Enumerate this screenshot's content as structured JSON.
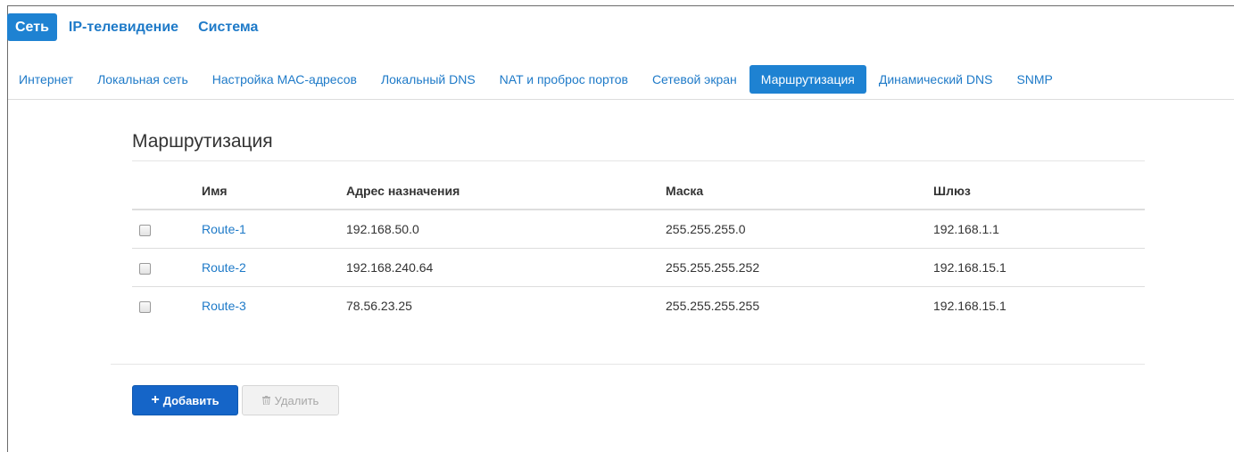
{
  "top_nav": {
    "items": [
      {
        "label": "Сеть",
        "active": true
      },
      {
        "label": "IP-телевидение",
        "active": false
      },
      {
        "label": "Система",
        "active": false
      }
    ]
  },
  "sub_nav": {
    "items": [
      {
        "label": "Интернет",
        "active": false
      },
      {
        "label": "Локальная сеть",
        "active": false
      },
      {
        "label": "Настройка МАС-адресов",
        "active": false
      },
      {
        "label": "Локальный DNS",
        "active": false
      },
      {
        "label": "NAT и проброс портов",
        "active": false
      },
      {
        "label": "Сетевой экран",
        "active": false
      },
      {
        "label": "Маршрутизация",
        "active": true
      },
      {
        "label": "Динамический DNS",
        "active": false
      },
      {
        "label": "SNMP",
        "active": false
      }
    ]
  },
  "page": {
    "title": "Маршрутизация"
  },
  "table": {
    "headers": {
      "name": "Имя",
      "destination": "Адрес назначения",
      "mask": "Маска",
      "gateway": "Шлюз"
    },
    "rows": [
      {
        "name": "Route-1",
        "destination": "192.168.50.0",
        "mask": "255.255.255.0",
        "gateway": "192.168.1.1",
        "checked": false
      },
      {
        "name": "Route-2",
        "destination": "192.168.240.64",
        "mask": "255.255.255.252",
        "gateway": "192.168.15.1",
        "checked": false
      },
      {
        "name": "Route-3",
        "destination": "78.56.23.25",
        "mask": "255.255.255.255",
        "gateway": "192.168.15.1",
        "checked": false
      }
    ]
  },
  "actions": {
    "add_label": "Добавить",
    "add_icon": "plus-icon",
    "delete_label": "Удалить",
    "delete_icon": "trash-icon",
    "delete_disabled": true
  },
  "colors": {
    "accent": "#1e82d2",
    "link": "#1e7ac8",
    "primary_button": "#1565c8"
  }
}
